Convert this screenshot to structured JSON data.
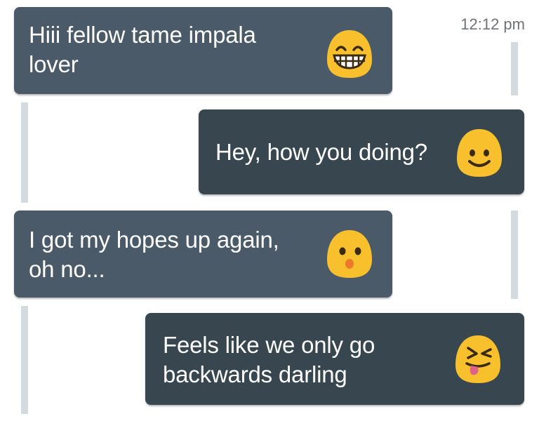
{
  "conversation": {
    "timestamp": "12:12 pm",
    "messages": [
      {
        "direction": "incoming",
        "text": "Hiii fellow tame impala\nlover",
        "emoji": "grinning-face-icon"
      },
      {
        "direction": "outgoing",
        "text": "Hey, how you doing?",
        "emoji": "smiling-face-icon"
      },
      {
        "direction": "incoming",
        "text": "I got my hopes up again,\noh no...",
        "emoji": "hushed-face-icon"
      },
      {
        "direction": "outgoing",
        "text": "Feels like we only go\nbackwards darling",
        "emoji": "squinting-tongue-face-icon"
      }
    ]
  },
  "colors": {
    "incoming_bubble": "#4a5a68",
    "outgoing_bubble": "#37464f",
    "timeline_bar": "#d3dbe0",
    "emoji_yellow": "#f7c02c",
    "timestamp_text": "#6f7378"
  }
}
